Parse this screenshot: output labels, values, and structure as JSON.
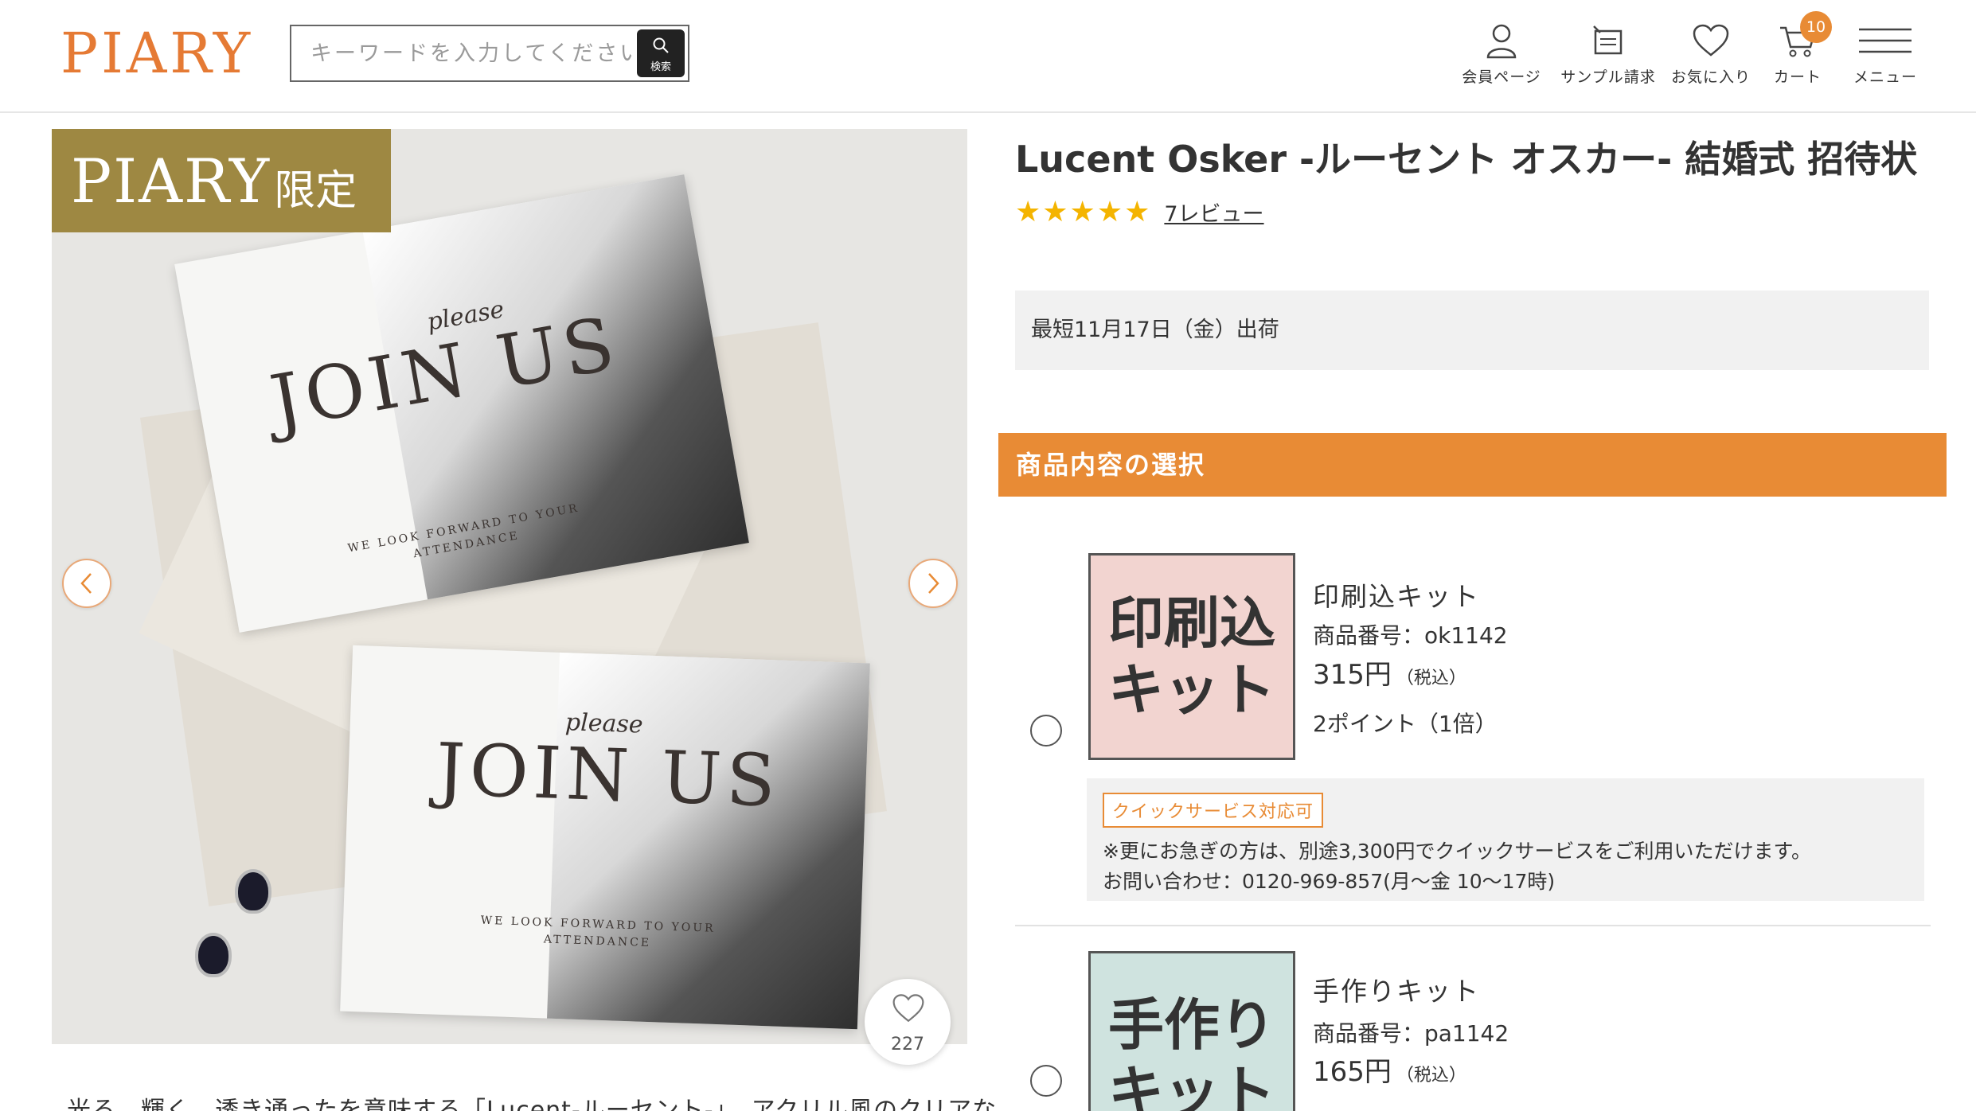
{
  "header": {
    "logo": "PIARY",
    "search": {
      "placeholder": "キーワードを入力してください",
      "button_label": "検索"
    },
    "nav": [
      {
        "label": "会員ページ",
        "icon": "user-icon"
      },
      {
        "label": "サンプル請求",
        "icon": "sample-icon"
      },
      {
        "label": "お気に入り",
        "icon": "heart-icon"
      },
      {
        "label": "カート",
        "icon": "cart-icon",
        "badge": "10"
      },
      {
        "label": "メニュー",
        "icon": "hamburger-icon"
      }
    ]
  },
  "gallery": {
    "badge_brand": "PIARY",
    "badge_suffix": "限定",
    "card_script": "please",
    "card_title": "JOIN US",
    "card_footer_1": "WE LOOK FORWARD TO YOUR",
    "card_footer_2": "ATTENDANCE",
    "favorite_count": "227",
    "description": "光る、輝く、透き通ったを意味する「Lucent-ルーセント-」。アクリル風のクリアな"
  },
  "product": {
    "title": "Lucent Osker -ルーセント オスカー- 結婚式 招待状",
    "rating_stars": "★★★★★",
    "rating_value": 5,
    "reviews_link": "7レビュー",
    "shipping": "最短11月17日（金）出荷",
    "section_header": "商品内容の選択",
    "options": [
      {
        "thumb_line1": "印刷込",
        "thumb_line2": "キット",
        "thumb_color": "#f2d4d0",
        "name": "印刷込キット",
        "code": "商品番号：ok1142",
        "price": "315円",
        "tax": "（税込）",
        "points": "2ポイント（1倍）"
      },
      {
        "thumb_line1": "手作り",
        "thumb_line2": "キット",
        "thumb_color": "#cfe3df",
        "name": "手作りキット",
        "code": "商品番号：pa1142",
        "price": "165円",
        "tax": "（税込）"
      }
    ],
    "quick_service": {
      "badge": "クイックサービス対応可",
      "line1": "※更にお急ぎの方は、別途3,300円でクイックサービスをご利用いただけます。",
      "line2": "お問い合わせ：0120-969-857(月〜金 10〜17時)"
    }
  },
  "colors": {
    "accent": "#e88b35",
    "logo": "#e57a34",
    "limited_badge": "#9e8842",
    "star": "#f4b400"
  }
}
